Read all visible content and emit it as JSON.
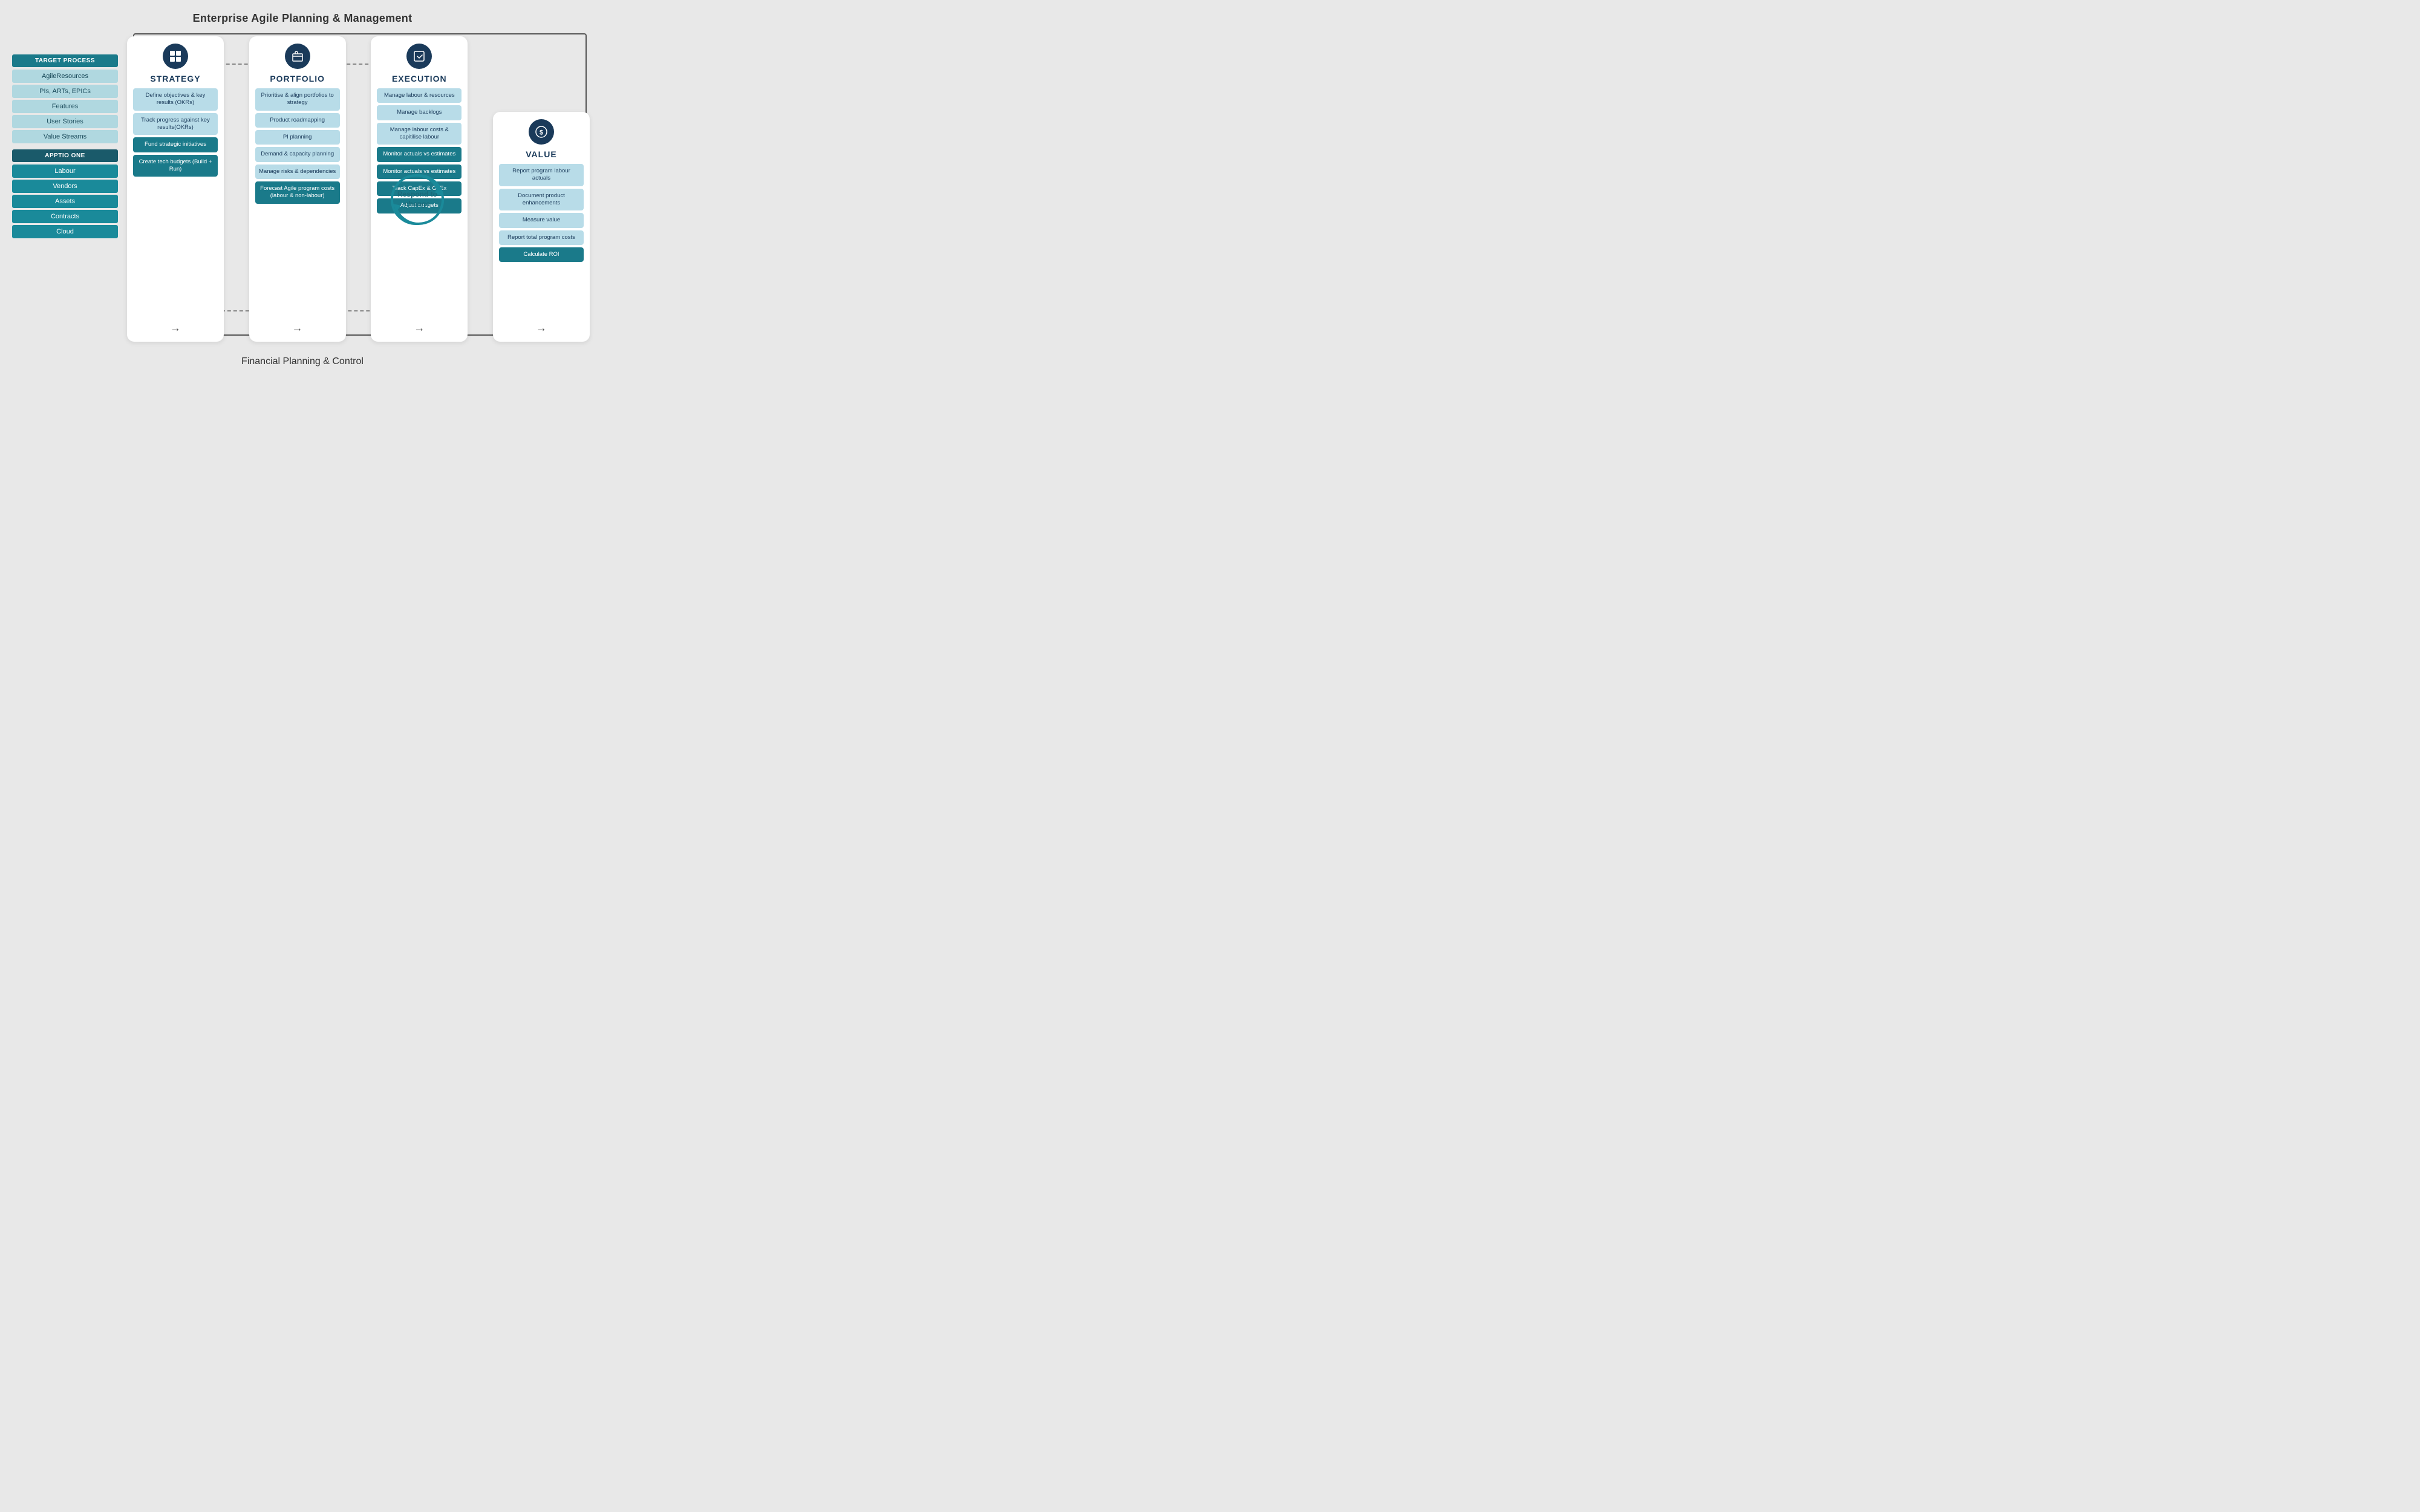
{
  "title": {
    "top": "Enterprise Agile Planning & Management",
    "bottom": "Financial Planning & Control"
  },
  "sidebar": {
    "section1_title": "TARGET PROCESS",
    "section1_items": [
      "AgileResources",
      "PIs, ARTs, EPICs",
      "Features",
      "User Stories",
      "Value Streams"
    ],
    "section2_title": "APPTIO ONE",
    "section2_items": [
      "Labour",
      "Vendors",
      "Assets",
      "Contracts",
      "Cloud"
    ]
  },
  "cards": [
    {
      "id": "strategy",
      "title": "STRATEGY",
      "icon": "⊞",
      "items": [
        {
          "text": "Define objectives & key results (OKRs)",
          "dark": false
        },
        {
          "text": "Track progress against key results(OKRs)",
          "dark": false
        },
        {
          "text": "Fund strategic initiatives",
          "dark": true
        },
        {
          "text": "Create tech budgets (Build + Run)",
          "dark": true
        }
      ]
    },
    {
      "id": "portfolio",
      "title": "PORTFOLIO",
      "icon": "🗂",
      "items": [
        {
          "text": "Prioritise & align portfolios to strategy",
          "dark": false
        },
        {
          "text": "Product roadmapping",
          "dark": false
        },
        {
          "text": "PI planning",
          "dark": false
        },
        {
          "text": "Demand & capacity planning",
          "dark": false
        },
        {
          "text": "Manage risks & dependencies",
          "dark": false
        },
        {
          "text": "Forecast Agile program costs (labour & non-labour)",
          "dark": true
        }
      ]
    },
    {
      "id": "execution",
      "title": "EXECUTION",
      "icon": "📦",
      "items": [
        {
          "text": "Manage labour & resources",
          "dark": false
        },
        {
          "text": "Manage backlogs",
          "dark": false
        },
        {
          "text": "Manage labour costs & capitilise labour",
          "dark": false
        },
        {
          "text": "Monitor actuals vs estimates",
          "dark": true
        },
        {
          "text": "Monitor actuals vs estimates",
          "dark": true
        },
        {
          "text": "Track CapEx & OpEx",
          "dark": true
        },
        {
          "text": "Adjust budgets",
          "dark": true
        }
      ]
    },
    {
      "id": "value",
      "title": "VALUE",
      "icon": "$",
      "items": [
        {
          "text": "Report program labour actuals",
          "dark": false
        },
        {
          "text": "Document product enhancements",
          "dark": false
        },
        {
          "text": "Measure value",
          "dark": false
        },
        {
          "text": "Report total program costs",
          "dark": false
        },
        {
          "text": "Calculate ROI",
          "dark": true
        }
      ]
    }
  ],
  "respond_to_change": "Respond to change",
  "arrow": "→"
}
